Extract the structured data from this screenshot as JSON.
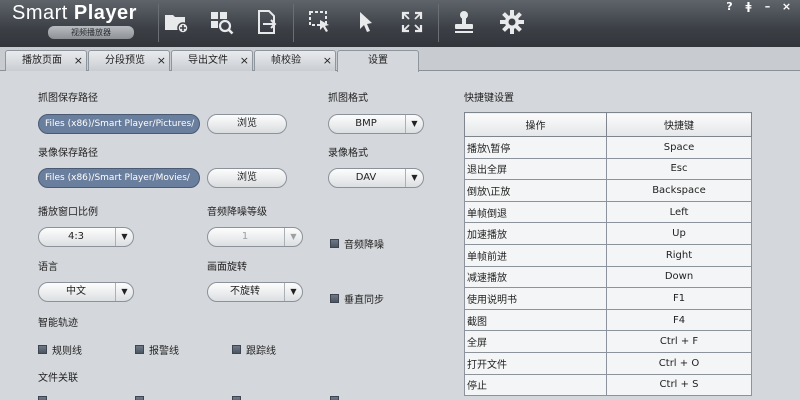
{
  "app": {
    "title_light": "Smart ",
    "title_bold": "Player",
    "subtitle": "视频播放器"
  },
  "toolbar": {
    "icons": [
      "open-folder-icon",
      "search-grid-icon",
      "export-file-icon",
      "select-region-icon",
      "pointer-icon",
      "fullscreen-icon",
      "stamp-icon",
      "gear-icon"
    ]
  },
  "window_controls": {
    "help": "?",
    "lock": "ǂ",
    "minimize": "–",
    "close": "×"
  },
  "tabs": [
    {
      "label": "播放页面",
      "close": "×"
    },
    {
      "label": "分段预览",
      "close": "×"
    },
    {
      "label": "导出文件",
      "close": "×"
    },
    {
      "label": "帧校验",
      "close": "×"
    },
    {
      "label": "设置",
      "close": ""
    }
  ],
  "settings": {
    "snapshot_path_label": "抓图保存路径",
    "snapshot_path_value": "Files (x86)/Smart Player/Pictures/",
    "browse_label": "浏览",
    "record_path_label": "录像保存路径",
    "record_path_value": "Files (x86)/Smart Player/Movies/",
    "snapshot_format_label": "抓图格式",
    "snapshot_format_value": "BMP",
    "record_format_label": "录像格式",
    "record_format_value": "DAV",
    "ratio_label": "播放窗口比例",
    "ratio_value": "4:3",
    "noise_level_label": "音频降噪等级",
    "noise_level_value": "1",
    "noise_reduce_label": "音频降噪",
    "language_label": "语言",
    "language_value": "中文",
    "rotate_label": "画面旋转",
    "rotate_value": "不旋转",
    "vsync_label": "垂直同步",
    "track_label": "智能轨迹",
    "rule_line_label": "规则线",
    "alarm_line_label": "报警线",
    "track_line_label": "跟踪线",
    "file_assoc_label": "文件关联"
  },
  "shortcuts": {
    "title": "快捷键设置",
    "col_op": "操作",
    "col_key": "快捷键",
    "rows": [
      {
        "op": "播放\\暂停",
        "key": "Space"
      },
      {
        "op": "退出全屏",
        "key": "Esc"
      },
      {
        "op": "倒放\\正放",
        "key": "Backspace"
      },
      {
        "op": "单帧倒退",
        "key": "Left"
      },
      {
        "op": "加速播放",
        "key": "Up"
      },
      {
        "op": "单帧前进",
        "key": "Right"
      },
      {
        "op": "减速播放",
        "key": "Down"
      },
      {
        "op": "使用说明书",
        "key": "F1"
      },
      {
        "op": "截图",
        "key": "F4"
      },
      {
        "op": "全屏",
        "key": "Ctrl + F"
      },
      {
        "op": "打开文件",
        "key": "Ctrl + O"
      },
      {
        "op": "停止",
        "key": "Ctrl + S"
      }
    ]
  },
  "colors": {
    "titlebar": "#3c4046",
    "path_field": "#6a7f9e",
    "background": "#d4d7db"
  }
}
